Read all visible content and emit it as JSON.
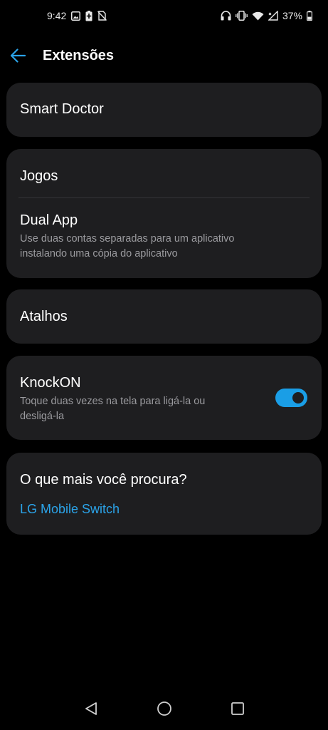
{
  "status_bar": {
    "time": "9:42",
    "battery_percent": "37%",
    "left_icons": [
      "image-icon",
      "battery-saver-icon",
      "no-sim-icon"
    ],
    "right_icons": [
      "headphones-icon",
      "vibrate-icon",
      "wifi-icon",
      "signal-icon",
      "battery-icon"
    ]
  },
  "header": {
    "title": "Extensões",
    "back_icon": "arrow-left-icon"
  },
  "sections": {
    "smart_doctor": {
      "title": "Smart Doctor"
    },
    "jogos": {
      "title": "Jogos"
    },
    "dual_app": {
      "title": "Dual App",
      "subtitle_line1": "Use duas contas separadas para um aplicativo",
      "subtitle_line2": "instalando uma cópia do aplicativo"
    },
    "atalhos": {
      "title": "Atalhos"
    },
    "knockon": {
      "title": "KnockON",
      "subtitle_line1": "Toque duas vezes na tela para ligá-la ou",
      "subtitle_line2": "desligá-la",
      "enabled": true
    },
    "suggestions": {
      "title": "O que mais você procura?",
      "link": "LG Mobile Switch"
    }
  },
  "colors": {
    "background": "#000000",
    "card": "#1e1e20",
    "accent": "#1a9ee6",
    "link": "#2ba3e8",
    "secondary_text": "#9a9a9e"
  },
  "nav_bar": {
    "buttons": [
      "back-triangle-icon",
      "home-circle-icon",
      "recents-square-icon"
    ]
  }
}
